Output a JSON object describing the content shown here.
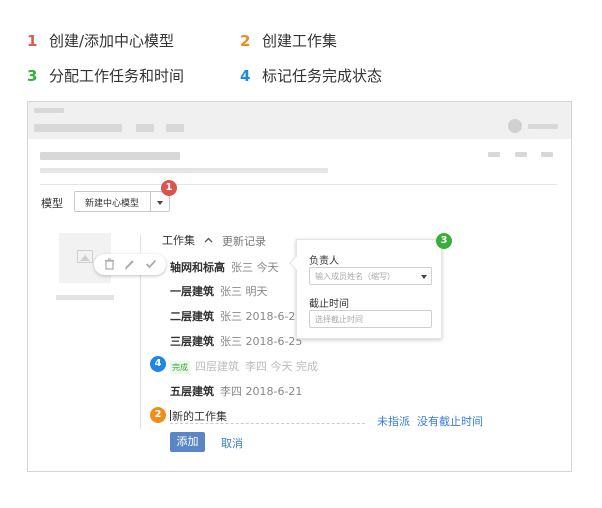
{
  "legend": [
    {
      "num": "1",
      "label": "创建/添加中心模型",
      "color": "#e05a4e"
    },
    {
      "num": "2",
      "label": "创建工作集",
      "color": "#f08c1a"
    },
    {
      "num": "3",
      "label": "分配工作任务和时间",
      "color": "#3aae3a"
    },
    {
      "num": "4",
      "label": "标记任务完成状态",
      "color": "#1e88e5"
    }
  ],
  "badges": {
    "b1": "1",
    "b2": "2",
    "b3": "3",
    "b4": "4"
  },
  "model": {
    "label": "模型",
    "selected": "新建中心模型"
  },
  "tabs": {
    "workset": "工作集",
    "history": "更新记录"
  },
  "tasks": [
    {
      "name": "轴网和标高",
      "meta": "张三 今天"
    },
    {
      "name": "一层建筑",
      "meta": "张三 明天"
    },
    {
      "name": "二层建筑",
      "meta": "张三 2018-6-22"
    },
    {
      "name": "三层建筑",
      "meta": "张三 2018-6-25"
    },
    {
      "name": "四层建筑",
      "meta": "李四 今天 完成",
      "done_tag": "完成"
    },
    {
      "name": "五层建筑",
      "meta": "李四 2018-6-21"
    }
  ],
  "popover": {
    "assignee_label": "负责人",
    "assignee_placeholder": "输入成员姓名（缩写）",
    "deadline_label": "截止时间",
    "deadline_placeholder": "选择截止时间"
  },
  "new_workset": {
    "placeholder": "新的工作集",
    "unassigned": "未指派",
    "no_deadline": "没有截止时间"
  },
  "buttons": {
    "add": "添加",
    "cancel": "取消"
  },
  "icons": {
    "delete": "trash-icon",
    "edit": "pencil-icon",
    "complete": "check-icon",
    "image": "image-placeholder-icon"
  }
}
